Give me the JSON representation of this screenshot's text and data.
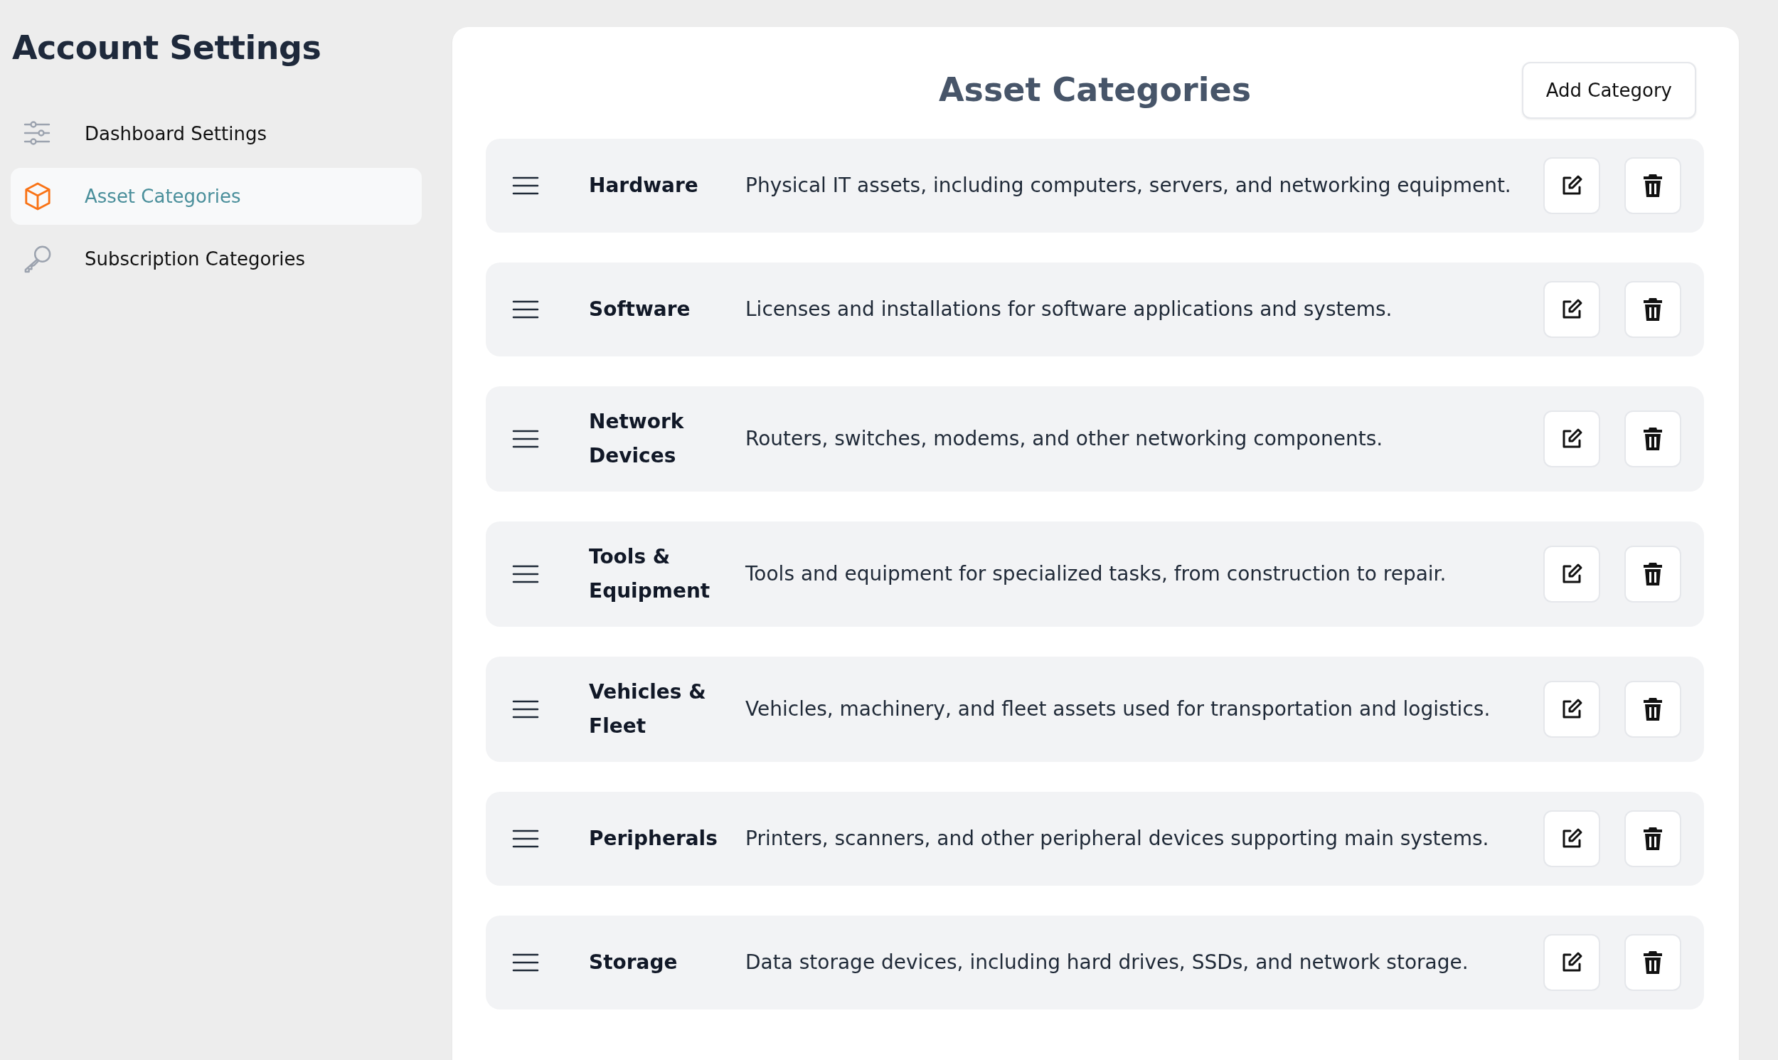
{
  "sidebar": {
    "title": "Account Settings",
    "items": [
      {
        "label": "Dashboard Settings",
        "kind": "sliders",
        "selected": false
      },
      {
        "label": "Asset Categories",
        "kind": "cube",
        "selected": true
      },
      {
        "label": "Subscription Categories",
        "kind": "key",
        "selected": false
      }
    ]
  },
  "panel": {
    "title": "Asset Categories",
    "add_button": "Add Category",
    "categories": [
      {
        "name": "Hardware",
        "description": "Physical IT assets, including computers, servers, and networking equipment."
      },
      {
        "name": "Software",
        "description": "Licenses and installations for software applications and systems."
      },
      {
        "name": "Network Devices",
        "description": "Routers, switches, modems, and other networking components."
      },
      {
        "name": "Tools & Equipment",
        "description": "Tools and equipment for specialized tasks, from construction to repair."
      },
      {
        "name": "Vehicles & Fleet",
        "description": "Vehicles, machinery, and fleet assets used for transportation and logistics."
      },
      {
        "name": "Peripherals",
        "description": "Printers, scanners, and other peripheral devices supporting main systems."
      },
      {
        "name": "Storage",
        "description": "Data storage devices, including hard drives, SSDs, and network storage."
      }
    ]
  }
}
